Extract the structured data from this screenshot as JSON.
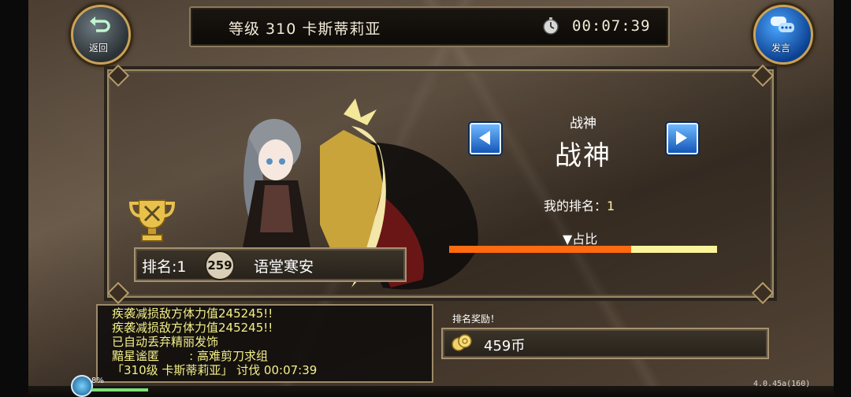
{
  "header": {
    "level_title": "等级 310 卡斯蒂莉亚",
    "timer": "00:07:39"
  },
  "buttons": {
    "back_label": "返回",
    "speak_label": "发言"
  },
  "ranking": {
    "category_small": "战神",
    "category_big": "战神",
    "my_rank_label": "我的排名：",
    "my_rank_value": "1",
    "ratio_label": "▼占比",
    "ratio_fraction": 0.68
  },
  "top_player": {
    "rank_text": "排名:1",
    "level": "259",
    "name": "语堂寒安"
  },
  "chat": {
    "lines": [
      "疾袭减损敌方体力值245245!!",
      "疾袭减损敌方体力值245245!!",
      "已自动丢弃精丽发饰",
      "黯星谧匿        : 高难剪刀求组",
      "「310级 卡斯蒂莉亚」 讨伐 00:07:39"
    ]
  },
  "reward": {
    "label": "排名奖励！",
    "amount": "459币"
  },
  "status": {
    "battery_pct": "8%",
    "version": "4.0.45a(160)"
  },
  "colors": {
    "accent_gold": "#c9a25a",
    "bar_fill": "#ff6a10",
    "bar_empty": "#fbf39a",
    "chat_text": "#f4f08a"
  }
}
